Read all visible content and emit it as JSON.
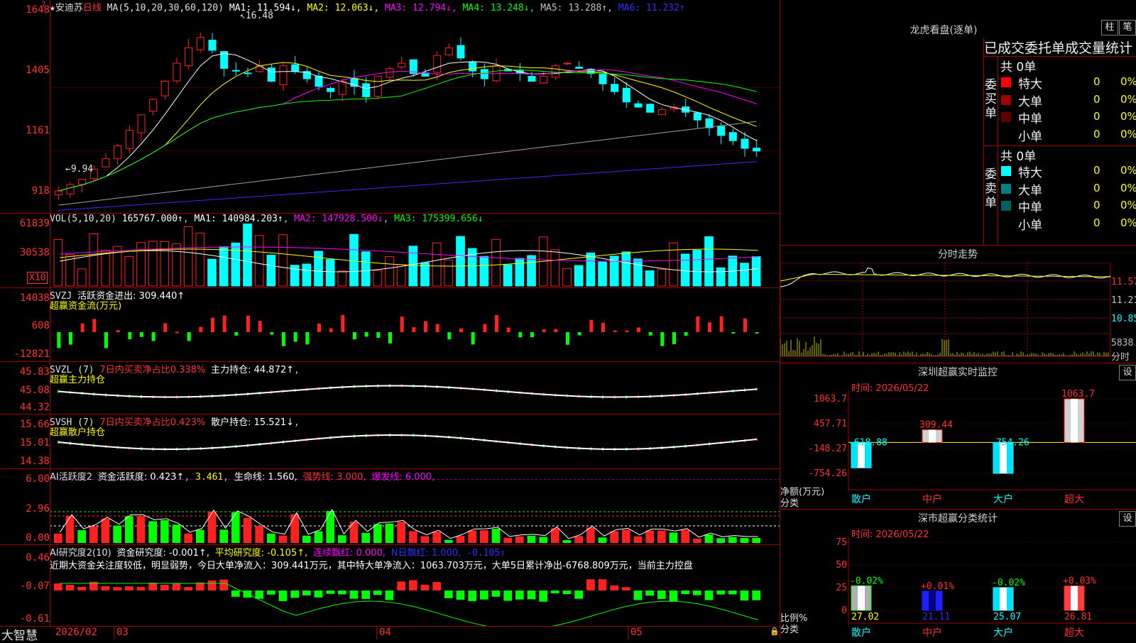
{
  "stock": {
    "name": "★安迪苏",
    "period": "日线"
  },
  "main_header": {
    "ma_label": "MA(5,10,20,30,60,120)",
    "items": [
      {
        "text": "MA1: 11.594↓",
        "color": "#ffffff"
      },
      {
        "text": "MA2: 12.063↓",
        "color": "#ffff00"
      },
      {
        "text": "MA3: 12.794↓",
        "color": "#ff00ff"
      },
      {
        "text": "MA4: 13.248↓",
        "color": "#00ff00"
      },
      {
        "text": "MA5: 13.288↑",
        "color": "#c0c0c0"
      },
      {
        "text": "MA6: 11.232↑",
        "color": "#3030ff"
      }
    ],
    "high_marker": "16.48",
    "low_marker": "9.94"
  },
  "main_axis": [
    "1648",
    "1405",
    "1161",
    "918"
  ],
  "vol": {
    "label": "VOL(5,10,20)",
    "value": "165767.000↑",
    "ma1": "MA1: 140984.203↑",
    "ma2": "MA2: 147928.500↓",
    "ma3": "MA3: 175399.656↓",
    "axis": [
      "61839",
      "30538"
    ],
    "unit": "X10"
  },
  "svzj": {
    "label": "SVZJ",
    "desc": "活跃资金进出: 309.440↑",
    "sub": "超赢资金流(万元)",
    "axis": [
      "14038",
      "608",
      "-12821"
    ]
  },
  "svzl": {
    "label": "SVZL (7)",
    "desc": "7日内买卖净占比0.338%",
    "extra": "主力持仓: 44.872↑",
    "sub": "超赢主力持仓",
    "axis": [
      "45.83",
      "45.08",
      "44.32"
    ]
  },
  "svsh": {
    "label": "SVSH (7)",
    "desc": "7日内买卖净占比0.423%",
    "extra": "散户持仓: 15.521↓",
    "sub": "超赢散户持仓",
    "axis": [
      "15.66",
      "15.01",
      "14.38"
    ]
  },
  "ai1": {
    "label": "AI活跃度2",
    "desc": "资金活跃度: 0.423↑",
    "v2": "3.461",
    "v3": "生命线: 1.560,",
    "v4": "强势线: 3.000,",
    "v5": "爆发线: 6.000,",
    "axis": [
      "6.00",
      "2.96",
      "0.00"
    ]
  },
  "ai2": {
    "label": "AI研究度2(10)",
    "desc": "资金研究度: -0.001↑,",
    "v2": "平均研究度: -0.105↑,",
    "v3": "连续飘红: 0.000,",
    "v4": "N日飘红: 1.000,",
    "v5": "-0.105↑",
    "comment": "近期大资金关注度较低，明显弱势，今日大单净流入：309.441万元，其中特大单净流入：1063.703万元，大单5日累计净出-6768.809万元，当前主力控盘",
    "axis": [
      "0.46",
      "-0.07",
      "-0.61"
    ]
  },
  "bottom": {
    "brand": "大智慧",
    "dates": [
      "2026/02",
      "03",
      "04",
      "05"
    ]
  },
  "longhu": {
    "title": "龙虎看盘(逐单)",
    "btn1": "柱",
    "btn2": "笔",
    "tabs": "已成交委托单成交量统计",
    "buy_label": "委买单",
    "sell_label": "委卖单",
    "buy_total": "共 0单",
    "sell_total": "共 0单",
    "buy_rows": [
      {
        "name": "特大",
        "v": "0",
        "p": "0%",
        "color": "#ff0000"
      },
      {
        "name": "大单",
        "v": "0",
        "p": "0%",
        "color": "#a00000"
      },
      {
        "name": "中单",
        "v": "0",
        "p": "0%",
        "color": "#600000"
      },
      {
        "name": "小单",
        "v": "0",
        "p": "0%",
        "color": "#000000"
      }
    ],
    "sell_rows": [
      {
        "name": "特大",
        "v": "0",
        "p": "0%",
        "color": "#00ffff"
      },
      {
        "name": "大单",
        "v": "0",
        "p": "0%",
        "color": "#008080"
      },
      {
        "name": "中单",
        "v": "0",
        "p": "0%",
        "color": "#006060"
      },
      {
        "name": "小单",
        "v": "0",
        "p": "0%",
        "color": "#000000"
      }
    ]
  },
  "intraday": {
    "title": "分时走势",
    "axis": [
      "11.57",
      "11.21",
      "10.85",
      "5838"
    ],
    "unit": "分时"
  },
  "sz_monitor": {
    "title": "深圳超赢实时监控",
    "gear": "设",
    "time": "时间: 2026/05/22",
    "axis": [
      "1063.7",
      "457.71",
      "-148.27",
      "-754.26"
    ],
    "y_unit": "净额(万元)",
    "x_unit": "分类",
    "cats": [
      "散户",
      "中户",
      "大户",
      "超大"
    ],
    "vals": [
      -618.88,
      309.44,
      -754.26,
      1063.7
    ],
    "labels": [
      "-618.88",
      "309.44",
      "-754.26",
      "1063.7"
    ]
  },
  "sz_class": {
    "title": "深市超赢分类统计",
    "gear": "设",
    "time": "时间: 2026/05/22",
    "axis": [
      "75",
      "50",
      "25",
      "0"
    ],
    "y_unit": "比例%",
    "x_unit": "分类",
    "cats": [
      "散户",
      "中户",
      "大户",
      "超大"
    ],
    "vals": [
      27.02,
      21.11,
      25.07,
      26.81
    ],
    "vals_text": [
      "27.02",
      "21.11",
      "25.07",
      "26.81"
    ],
    "changes": [
      "-0.02%",
      "+0.01%",
      "-0.02%",
      "+0.03%"
    ]
  },
  "colors": {
    "up": "#ff2020",
    "down": "#00ffff",
    "grid": "#a00000",
    "label": "#ff3030"
  }
}
